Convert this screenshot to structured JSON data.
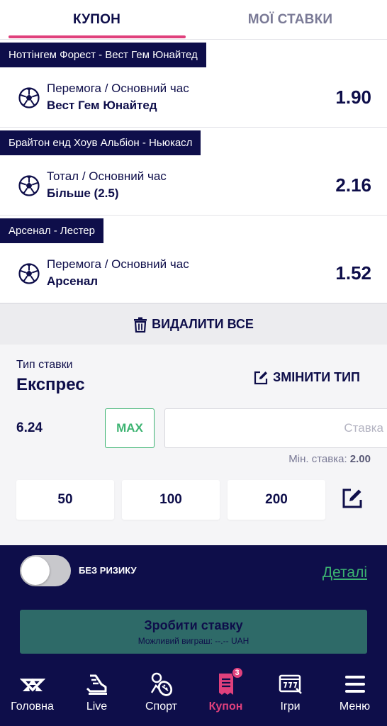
{
  "tabs": [
    {
      "label": "КУПОН",
      "active": true
    },
    {
      "label": "МОЇ СТАВКИ",
      "active": false
    }
  ],
  "bets": [
    {
      "match": "Ноттінгем Форест - Вест Гем Юнайтед",
      "market": "Перемога / Основний час",
      "selection": "Вест Гем Юнайтед",
      "odds": "1.90",
      "icon": "soccer-ball-icon"
    },
    {
      "match": "Брайтон енд Хоув Альбіон - Ньюкасл",
      "market": "Тотал / Основний час",
      "selection": "Більше (2.5)",
      "odds": "2.16",
      "icon": "soccer-ball-icon"
    },
    {
      "match": "Арсенал - Лестер",
      "market": "Перемога / Основний час",
      "selection": "Арсенал",
      "odds": "1.52",
      "icon": "soccer-ball-icon"
    }
  ],
  "delete_all": {
    "label": "ВИДАЛИТИ ВСЕ",
    "icon": "trash-icon"
  },
  "bet_type": {
    "caption": "Тип ставки",
    "value": "Експрес",
    "change_label": "ЗМІНИТИ ТИП",
    "change_icon": "edit-icon"
  },
  "stake": {
    "total_odds": "6.24",
    "max_label": "MAX",
    "placeholder": "Ставка",
    "min_label": "Мін. ставка:",
    "min_value": "2.00",
    "quick_amounts": [
      "50",
      "100",
      "200"
    ],
    "edit_icon": "edit-icon"
  },
  "no_risk": {
    "label": "БЕЗ РИЗИКУ",
    "enabled": false
  },
  "details_link": "Деталі",
  "place_bet": {
    "title": "Зробити ставку",
    "subtitle": "Можливий виграш: --.-- UAH"
  },
  "nav": [
    {
      "label": "Головна",
      "icon": "home-logo-icon",
      "active": false
    },
    {
      "label": "Live",
      "icon": "live-icon",
      "active": false
    },
    {
      "label": "Спорт",
      "icon": "sport-icon",
      "active": false
    },
    {
      "label": "Купон",
      "icon": "coupon-icon",
      "active": true,
      "badge": "3"
    },
    {
      "label": "Ігри",
      "icon": "games-icon",
      "active": false
    },
    {
      "label": "Меню",
      "icon": "menu-icon",
      "active": false
    }
  ],
  "colors": {
    "navy": "#0e0e4a",
    "accent_pink": "#e0407c",
    "green": "#3cb371",
    "place_bet_bg": "#2e6a68"
  }
}
